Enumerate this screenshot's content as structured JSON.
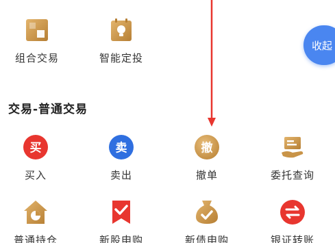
{
  "top_items": [
    {
      "label": "组合交易",
      "icon": "portfolio-trade-icon",
      "color": "#c99448"
    },
    {
      "label": "智能定投",
      "icon": "smart-investment-icon",
      "color": "#c99448"
    }
  ],
  "section_title": "交易-普通交易",
  "trade_items": [
    {
      "label": "买入",
      "icon_text": "买",
      "icon": "buy-icon",
      "color": "#e8362f"
    },
    {
      "label": "卖出",
      "icon_text": "卖",
      "icon": "sell-icon",
      "color": "#2f6fe0"
    },
    {
      "label": "撤单",
      "icon_text": "撤",
      "icon": "cancel-order-icon",
      "color": "#c99448"
    },
    {
      "label": "委托查询",
      "icon": "order-query-icon",
      "color": "#c99448"
    },
    {
      "label": "普通持仓",
      "icon": "holdings-icon",
      "color": "#c99448"
    },
    {
      "label": "新股申购",
      "icon": "new-stock-subscribe-icon",
      "color": "#e8362f"
    },
    {
      "label": "新债申购",
      "icon": "new-bond-subscribe-icon",
      "color": "#c99448"
    },
    {
      "label": "银证转账",
      "icon": "bank-transfer-icon",
      "color": "#e8362f"
    }
  ],
  "collapse_button": {
    "label": "收起",
    "color": "#4a86f0"
  },
  "annotation_arrow": {
    "icon": "down-arrow-icon",
    "color": "#e8362f"
  }
}
